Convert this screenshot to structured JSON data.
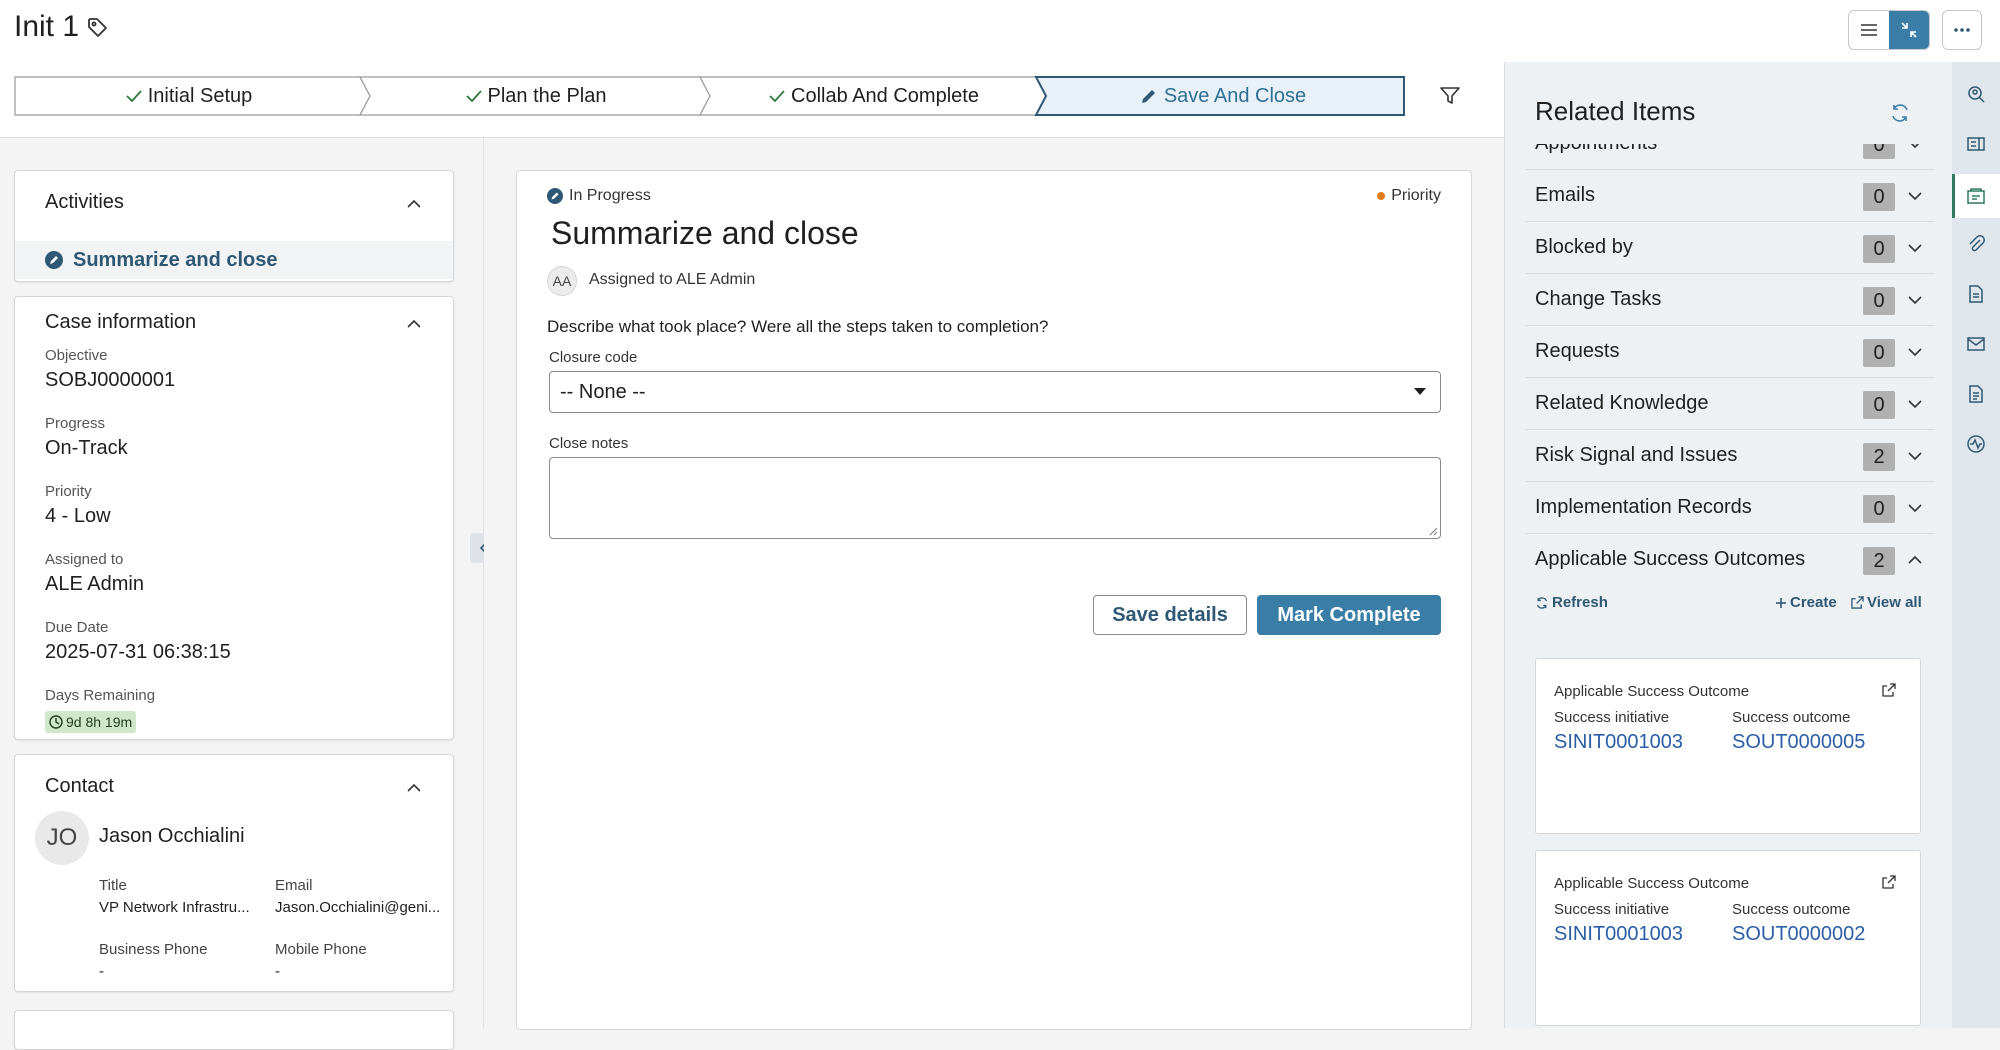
{
  "header": {
    "title": "Init 1",
    "icons": {
      "tag": "tag-icon",
      "list_view": "list-view-icon",
      "split_view": "split-view-icon",
      "more": "more-icon"
    }
  },
  "stages": [
    {
      "label": "Initial Setup",
      "status": "complete"
    },
    {
      "label": "Plan the Plan",
      "status": "complete"
    },
    {
      "label": "Collab And Complete",
      "status": "complete"
    },
    {
      "label": "Save And Close",
      "status": "current"
    }
  ],
  "activities": {
    "title": "Activities",
    "items": [
      {
        "label": "Summarize and close"
      }
    ]
  },
  "case_info": {
    "title": "Case information",
    "fields": [
      {
        "label": "Objective",
        "value": "SOBJ0000001"
      },
      {
        "label": "Progress",
        "value": "On-Track"
      },
      {
        "label": "Priority",
        "value": "4 - Low"
      },
      {
        "label": "Assigned to",
        "value": "ALE Admin"
      },
      {
        "label": "Due Date",
        "value": "2025-07-31 06:38:15"
      },
      {
        "label": "Days Remaining",
        "value": "9d 8h 19m"
      }
    ]
  },
  "contact": {
    "title": "Contact",
    "initials": "JO",
    "name": "Jason Occhialini",
    "fields": [
      {
        "label": "Title",
        "value": "VP Network Infrastru..."
      },
      {
        "label": "Email",
        "value": "Jason.Occhialini@geni..."
      },
      {
        "label": "Business Phone",
        "value": "-"
      },
      {
        "label": "Mobile Phone",
        "value": "-"
      }
    ]
  },
  "task": {
    "state": "In Progress",
    "priority": "Priority",
    "title": "Summarize and close",
    "assignee_initials": "AA",
    "assigned_text": "Assigned to ALE Admin",
    "question": "Describe what took place? Were all the steps taken to completion?",
    "closure_code_label": "Closure code",
    "closure_code_value": "-- None --",
    "close_notes_label": "Close notes",
    "save_label": "Save details",
    "complete_label": "Mark Complete"
  },
  "related": {
    "title": "Related Items",
    "items": [
      {
        "label": "Appointments",
        "count": "0"
      },
      {
        "label": "Emails",
        "count": "0"
      },
      {
        "label": "Blocked by",
        "count": "0"
      },
      {
        "label": "Change Tasks",
        "count": "0"
      },
      {
        "label": "Requests",
        "count": "0"
      },
      {
        "label": "Related Knowledge",
        "count": "0"
      },
      {
        "label": "Risk Signal and Issues",
        "count": "2"
      },
      {
        "label": "Implementation Records",
        "count": "0"
      },
      {
        "label": "Applicable Success Outcomes",
        "count": "2"
      }
    ],
    "actions": {
      "refresh": "Refresh",
      "create": "Create",
      "view_all": "View all"
    },
    "outcomes": [
      {
        "header": "Applicable Success Outcome",
        "initiative_label": "Success initiative",
        "initiative": "SINIT0001003",
        "outcome_label": "Success outcome",
        "outcome": "SOUT0000005"
      },
      {
        "header": "Applicable Success Outcome",
        "initiative_label": "Success initiative",
        "initiative": "SINIT0001003",
        "outcome_label": "Success outcome",
        "outcome": "SOUT0000002"
      }
    ]
  },
  "colors": {
    "accent": "#3a7ea8",
    "link": "#2b5ea7",
    "priority_dot": "#e07b1f",
    "badge_bg": "#cfe8c9"
  }
}
